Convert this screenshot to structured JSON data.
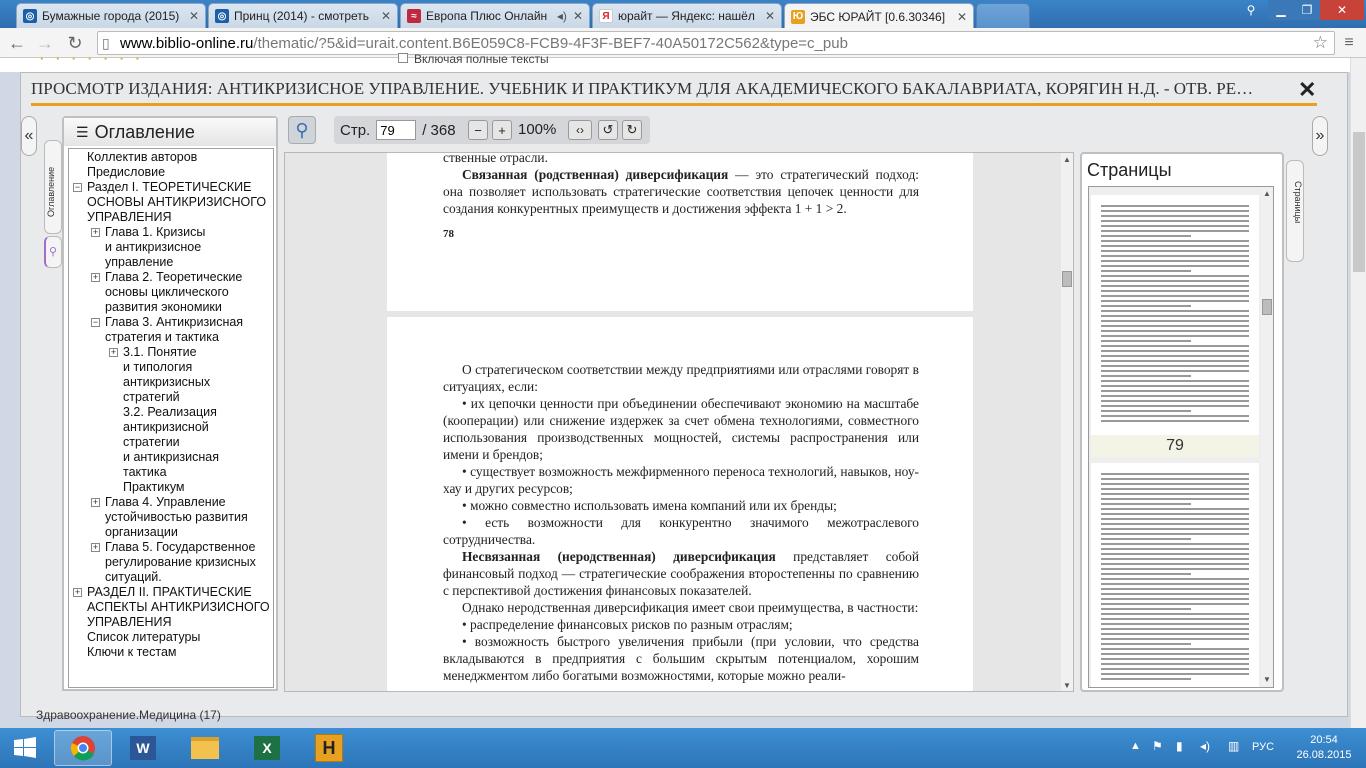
{
  "browser": {
    "tabs": [
      {
        "title": "Бумажные города (2015)",
        "favicon_color": "#1b5fa8"
      },
      {
        "title": "Принц (2014) - смотреть",
        "favicon_color": "#1b5fa8"
      },
      {
        "title": "Европа Плюс Онлайн",
        "favicon_color": "#c0283b"
      },
      {
        "title": "юрайт — Яндекс: нашёл",
        "favicon_color": "#e02020",
        "favicon_letter": "Я"
      },
      {
        "title": "ЭБС ЮРАЙТ [0.6.30346]",
        "favicon_color": "#e8a020"
      }
    ],
    "url_domain": "www.biblio-online.ru",
    "url_rest": "/thematic/?5&id=urait.content.B6E059C8-FCB9-4F3F-BEF7-40A50172C562&type=c_pub"
  },
  "underlying_page": {
    "checkbox_label": "Включая полные тексты",
    "bottom_text": "Здравоохранение.Медицина (17)"
  },
  "modal": {
    "title": "ПРОСМОТР ИЗДАНИЯ: АНТИКРИЗИСНОЕ УПРАВЛЕНИЕ. УЧЕБНИК И ПРАКТИКУМ ДЛЯ АКАДЕМИЧЕСКОГО БАКАЛАВРИАТА, КОРЯГИН Н.Д. - ОТВ. РЕ…",
    "close_symbol": "✕",
    "accent_color": "#e8a020"
  },
  "toc": {
    "heading": "Оглавление",
    "side_tab_label": "Оглавление",
    "items": [
      {
        "lines": [
          "Коллектив авторов"
        ],
        "level": 0,
        "toggle": ""
      },
      {
        "lines": [
          "Предисловие"
        ],
        "level": 0,
        "toggle": ""
      },
      {
        "lines": [
          "Раздел I. ТЕОРЕТИЧЕСКИЕ",
          "ОСНОВЫ АНТИКРИЗИСНОГО",
          "УПРАВЛЕНИЯ"
        ],
        "level": 0,
        "toggle": "−"
      },
      {
        "lines": [
          "Глава 1. Кризисы",
          "и антикризисное",
          "управление"
        ],
        "level": 1,
        "toggle": "+"
      },
      {
        "lines": [
          "Глава 2. Теоретические",
          "основы циклического",
          "развития экономики"
        ],
        "level": 1,
        "toggle": "+"
      },
      {
        "lines": [
          "Глава 3. Антикризисная",
          "стратегия и тактика"
        ],
        "level": 1,
        "toggle": "−"
      },
      {
        "lines": [
          "3.1. Понятие",
          "и типология",
          "антикризисных",
          "стратегий"
        ],
        "level": 2,
        "toggle": "+"
      },
      {
        "lines": [
          "3.2. Реализация",
          "антикризисной",
          "стратегии",
          "и антикризисная",
          "тактика"
        ],
        "level": 2,
        "toggle": ""
      },
      {
        "lines": [
          "Практикум"
        ],
        "level": 2,
        "toggle": ""
      },
      {
        "lines": [
          "Глава 4. Управление",
          "устойчивостью развития",
          "организации"
        ],
        "level": 1,
        "toggle": "+"
      },
      {
        "lines": [
          "Глава 5. Государственное",
          "регулирование кризисных",
          "ситуаций."
        ],
        "level": 1,
        "toggle": "+"
      },
      {
        "lines": [
          "РАЗДЕЛ II. ПРАКТИЧЕСКИЕ",
          "АСПЕКТЫ АНТИКРИЗИСНОГО",
          "УПРАВЛЕНИЯ"
        ],
        "level": 0,
        "toggle": "+"
      },
      {
        "lines": [
          "Список литературы"
        ],
        "level": 0,
        "toggle": ""
      },
      {
        "lines": [
          "Ключи к тестам"
        ],
        "level": 0,
        "toggle": ""
      }
    ]
  },
  "viewer_toolbar": {
    "page_label": "Стр.",
    "page_value": "79",
    "page_total": "/ 368",
    "zoom": "100%"
  },
  "document": {
    "page78": {
      "top_line": "ственные отрасли.",
      "para_bold": "Связанная (родственная) диверсификация",
      "para_rest": " — это стратегический подход: она позволяет использовать стратегические соответствия цепочек ценности для создания конкурентных преимуществ и достижения эффекта 1 + 1 > 2.",
      "page_number": "78"
    },
    "page79": {
      "intro": "О стратегическом соответствии между предприятиями или отраслями говорят в ситуациях, если:",
      "bullets1": [
        "•  их цепочки ценности при объединении обеспечивают экономию на масштабе (кооперации) или снижение издержек за счет обмена технологиями, совместного использования производственных мощностей, системы распространения или имени и брендов;",
        "•  существует возможность межфирменного переноса технологий, навыков, ноу-хау и других ресурсов;",
        "•  можно совместно использовать имена компаний или их бренды;",
        "•  есть возможности для конкурентно значимого межотраслевого сотрудничества."
      ],
      "para2_bold": "Несвязанная (неродственная) диверсификация",
      "para2_rest": " представляет собой финансовый подход — стратегические соображения второстепенны по сравнению с перспективой достижения финансовых показателей.",
      "para3": "Однако неродственная диверсификация имеет свои преимущества, в частности:",
      "bullets2": [
        "•  распределение финансовых рисков по разным отраслям;",
        "•  возможность быстрого увеличения прибыли (при условии, что средства вкладываются в предприятия с большим скрытым потенциалом, хорошим менеджментом либо богатыми возможностями, которые можно реали-"
      ]
    }
  },
  "pages_panel": {
    "heading": "Страницы",
    "side_tab_label": "Страницы",
    "current_thumb_number": "79"
  },
  "taskbar": {
    "lang": "РУС",
    "time": "20:54",
    "date": "26.08.2015"
  }
}
